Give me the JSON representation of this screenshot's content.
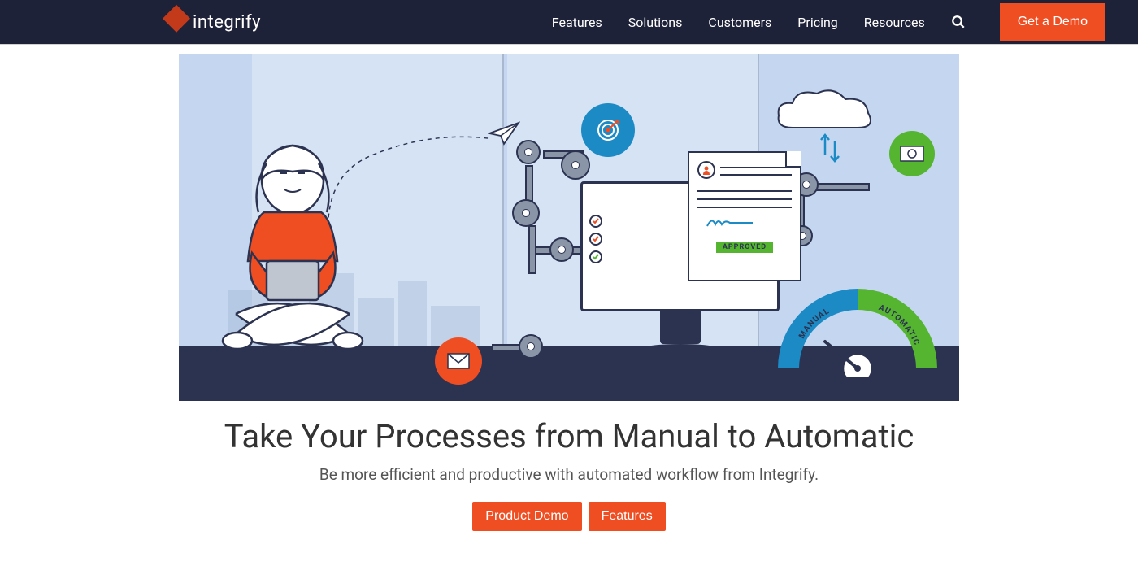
{
  "brand": {
    "name": "integrify"
  },
  "nav": {
    "items": [
      {
        "label": "Features"
      },
      {
        "label": "Solutions"
      },
      {
        "label": "Customers"
      },
      {
        "label": "Pricing"
      },
      {
        "label": "Resources"
      }
    ],
    "cta": "Get a Demo"
  },
  "hero": {
    "headline": "Take Your Processes from Manual to Automatic",
    "subhead": "Be more efficient and productive with automated workflow from Integrify.",
    "buttons": {
      "demo": "Product Demo",
      "features": "Features"
    },
    "illustration": {
      "gauge_manual": "MANUAL",
      "gauge_automatic": "AUTOMATIC",
      "doc_approved": "APPROVED"
    }
  },
  "colors": {
    "accent": "#ef4e23",
    "navbar": "#1e2238",
    "blue": "#1c8ac5",
    "green": "#55b531"
  }
}
